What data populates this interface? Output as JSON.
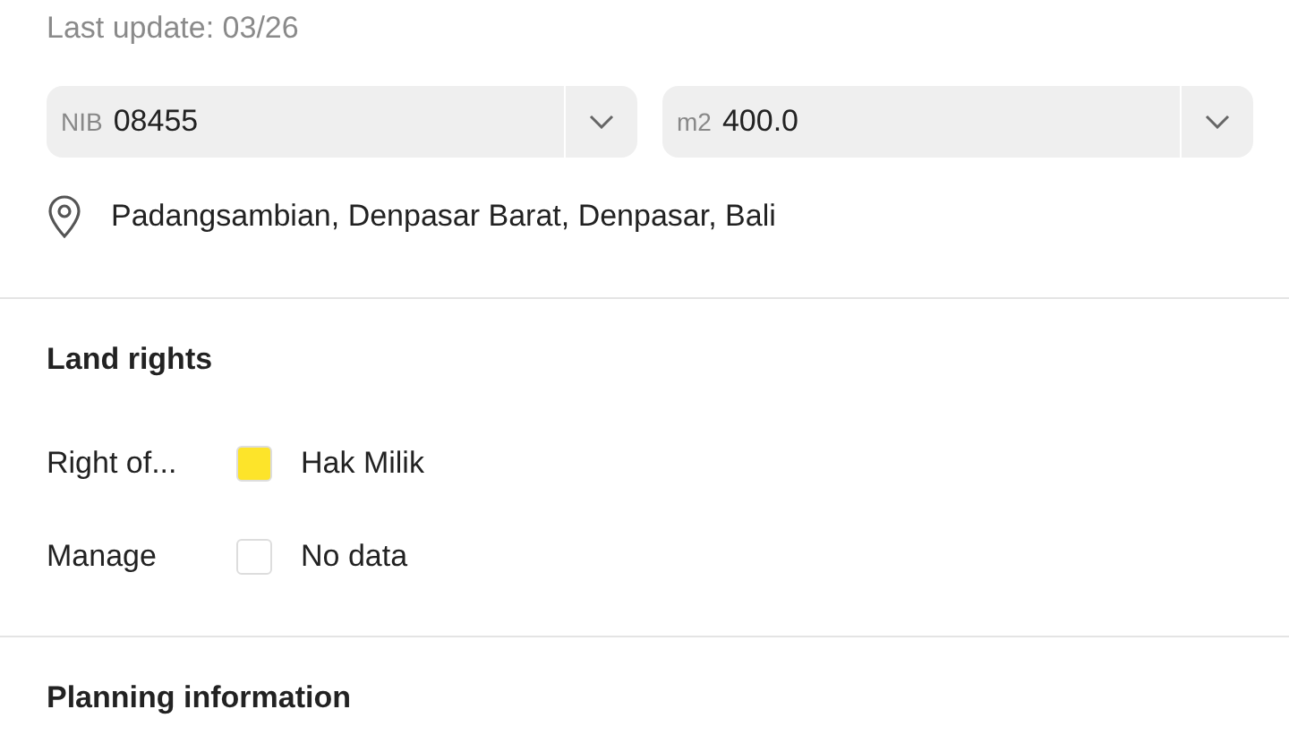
{
  "last_update": "Last update: 03/26",
  "fields": [
    {
      "prefix": "NIB",
      "value": "08455"
    },
    {
      "prefix": "m2",
      "value": "400.0"
    }
  ],
  "address": "Padangsambian, Denpasar Barat, Denpasar, Bali",
  "land_rights": {
    "title": "Land rights",
    "rows": [
      {
        "label": "Right of...",
        "color": "#fde42a",
        "value": "Hak Milik"
      },
      {
        "label": "Manage",
        "color": "#ffffff",
        "value": "No data"
      }
    ]
  },
  "planning": {
    "title": "Planning information"
  }
}
